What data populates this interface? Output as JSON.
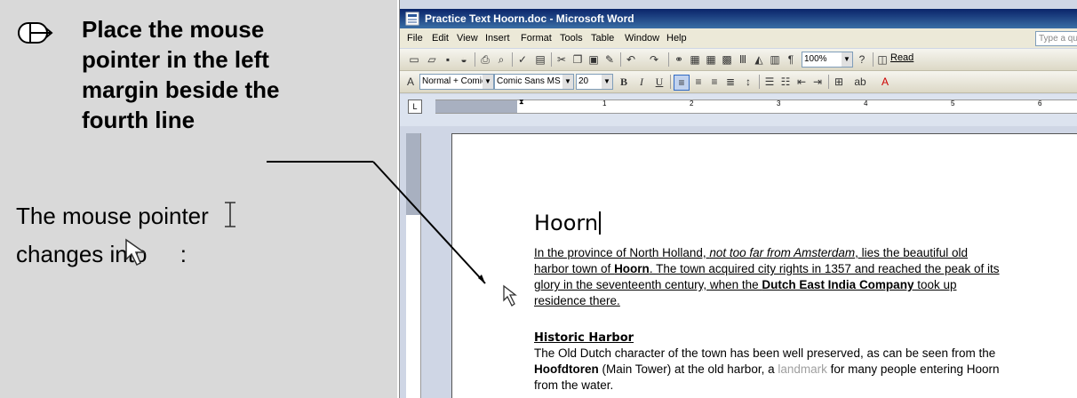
{
  "instruction": {
    "line1": "Place the mouse",
    "line2": "pointer in the left",
    "line3": "margin beside the",
    "line4": "fourth line",
    "info_line1": "The mouse pointer",
    "info_line2": "changes into",
    "info_line2_suffix": ":"
  },
  "window": {
    "title": "Practice Text Hoorn.doc - Microsoft Word",
    "menu": [
      "File",
      "Edit",
      "View",
      "Insert",
      "Format",
      "Tools",
      "Table",
      "Window",
      "Help"
    ],
    "help_placeholder": "Type a qu"
  },
  "toolbar": {
    "zoom": "100%",
    "read_label": "Read",
    "style": "Normal + Comic",
    "font": "Comic Sans MS",
    "size": "20",
    "bold": "B",
    "italic": "I",
    "underline": "U"
  },
  "ruler": {
    "numbers": [
      "1",
      "2",
      "3",
      "4",
      "5",
      "6"
    ]
  },
  "document": {
    "heading": "Hoorn",
    "p1_l1_a": "In the province of North Holland, ",
    "p1_l1_b": "not too far from Amsterdam",
    "p1_l1_c": ", lies the beautiful old",
    "p1_l2_a": "harbor town of ",
    "p1_l2_b": "Hoorn",
    "p1_l2_c": ". The town acquired city rights in 1357 and reached the peak of its",
    "p1_l3_a": "glory in the seventeenth century, when the ",
    "p1_l3_b": "Dutch East India Company",
    "p1_l3_c": " took up",
    "p1_l4": "residence there.",
    "subheading": "Historic Harbor",
    "p2_l1": "The Old Dutch character of the town has been well preserved, as can be seen from the",
    "p2_l2_a": "Hoofdtoren",
    "p2_l2_b": " (Main Tower) at the old harbor, a ",
    "p2_l2_c": "landmark",
    "p2_l2_d": " for many people entering Hoorn",
    "p2_l3": "from the water."
  }
}
